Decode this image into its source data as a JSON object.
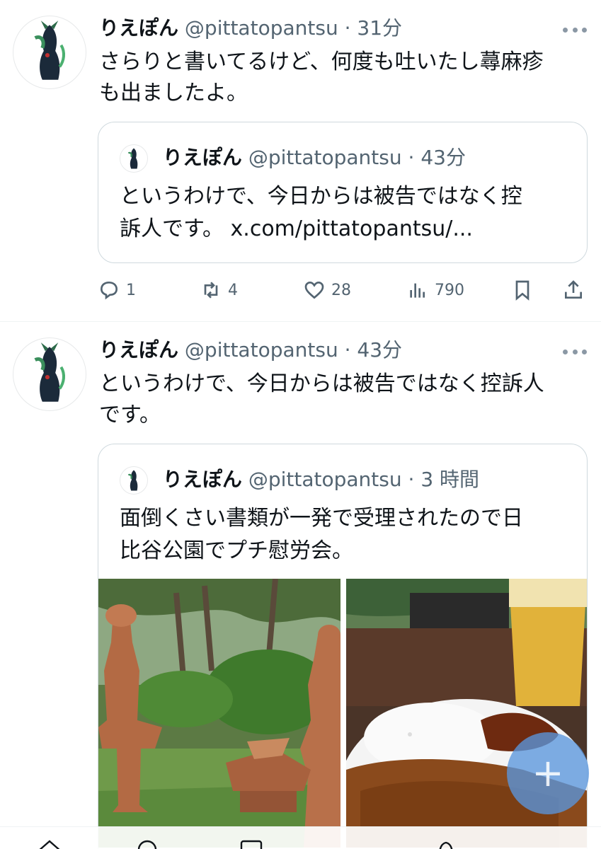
{
  "tweets": [
    {
      "author": {
        "name": "りえぽん",
        "handle": "@pittatopantsu"
      },
      "separator": "·",
      "time": "31分",
      "text_lines": [
        "さらりと書いてるけど、何度も吐いたし蕁麻疹",
        "も出ましたよ。"
      ],
      "quote": {
        "author": {
          "name": "りえぽん",
          "handle": "@pittatopantsu"
        },
        "separator": "·",
        "time": "43分",
        "text_lines": [
          "というわけで、今日からは被告ではなく控",
          "訴人です。 x.com/pittatopantsu/..."
        ]
      },
      "actions": {
        "replies": "1",
        "reposts": "4",
        "likes": "28",
        "views": "790"
      }
    },
    {
      "author": {
        "name": "りえぽん",
        "handle": "@pittatopantsu"
      },
      "separator": "·",
      "time": "43分",
      "text_lines": [
        "というわけで、今日からは被告ではなく控訴人",
        "です。"
      ],
      "quote": {
        "author": {
          "name": "りえぽん",
          "handle": "@pittatopantsu"
        },
        "separator": "·",
        "time": "3 時間",
        "text_lines": [
          "面倒くさい書類が一発で受理されたので日",
          "比谷公園でプチ慰労会。"
        ],
        "photos": [
          "haniwa-garden-photo",
          "curry-beer-photo"
        ]
      }
    }
  ],
  "icons": {
    "more": "more-dots-icon",
    "reply": "reply-icon",
    "repost": "repost-icon",
    "like": "heart-icon",
    "views": "views-icon",
    "bookmark": "bookmark-icon",
    "share": "share-icon",
    "compose": "plus-icon"
  },
  "fab_label": "+",
  "colors": {
    "text": "#0f1419",
    "secondary": "#536471",
    "border": "#cfd9de",
    "fab": "#5a96dc"
  }
}
